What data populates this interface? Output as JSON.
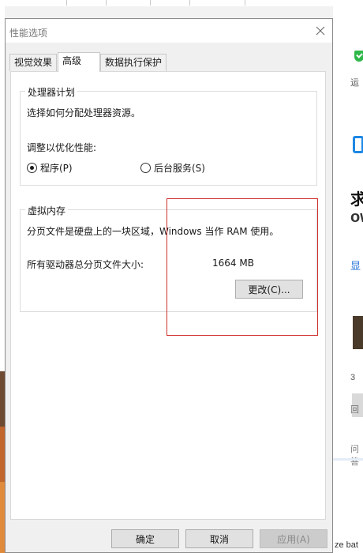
{
  "dialog": {
    "title": "性能选项",
    "tabs": [
      {
        "label": "视觉效果",
        "active": false
      },
      {
        "label": "高级",
        "active": true
      },
      {
        "label": "数据执行保护",
        "active": false
      }
    ]
  },
  "processor": {
    "legend": "处理器计划",
    "description": "选择如何分配处理器资源。",
    "adjust_label": "调整以优化性能:",
    "options": [
      {
        "label": "程序(P)",
        "checked": true
      },
      {
        "label": "后台服务(S)",
        "checked": false
      }
    ]
  },
  "virtual_memory": {
    "legend": "虚拟内存",
    "description": "分页文件是硬盘上的一块区域，Windows 当作 RAM 使用。",
    "total_label": "所有驱动器总分页文件大小:",
    "total_value": "1664 MB",
    "change_button": "更改(C)..."
  },
  "footer": {
    "ok": "确定",
    "cancel": "取消",
    "apply": "应用(A)"
  },
  "background": {
    "right_fragments": [
      "运",
      "求",
      "ow",
      "显",
      "3",
      "回",
      "问答"
    ],
    "bottom_right_text": "ze bat"
  },
  "colors": {
    "annotation_box": "#d0312d",
    "shield_green": "#2fb84a",
    "link_blue": "#1e6fd6"
  }
}
